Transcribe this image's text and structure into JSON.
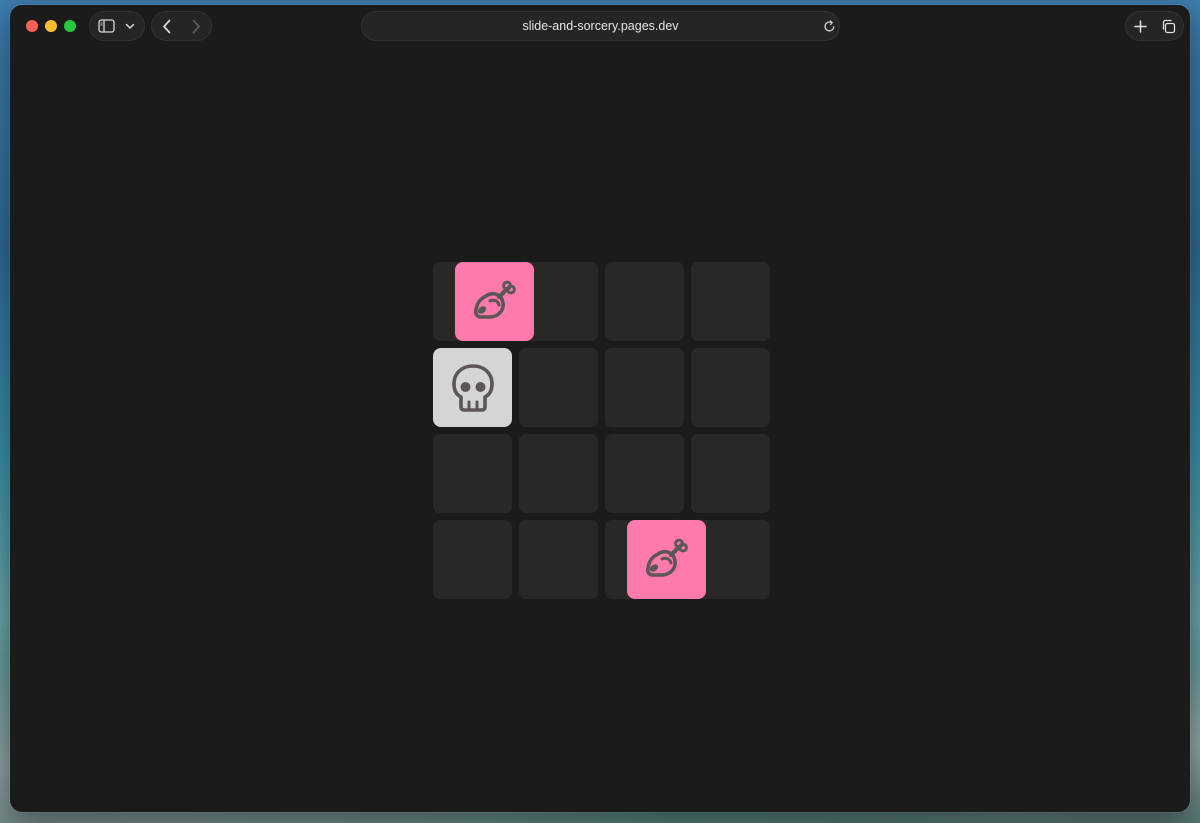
{
  "browser": {
    "url": "slide-and-sorcery.pages.dev",
    "icons": {
      "sidebar_toggle": "sidebar-icon",
      "sidebar_menu": "chevron-down-icon",
      "back": "chevron-left-icon",
      "forward": "chevron-right-icon",
      "reload": "reload-icon",
      "new_tab": "plus-icon",
      "tabs_overview": "tabs-icon"
    },
    "colors": {
      "window_bg": "#1c1b1b",
      "toolbar_pill": "#262525",
      "close": "#fe5f57",
      "minimize": "#febc2e",
      "maximize": "#28c840"
    }
  },
  "game": {
    "grid": {
      "rows": 4,
      "cols": 4
    },
    "tiles": [
      {
        "kind": "food",
        "icon": "meat-icon",
        "row": 0,
        "col": 0.26
      },
      {
        "kind": "enemy",
        "icon": "skull-icon",
        "row": 1,
        "col": 0
      },
      {
        "kind": "food",
        "icon": "meat-icon",
        "row": 3,
        "col": 2.26
      }
    ],
    "colors": {
      "cell": "#2a2727",
      "food_tile": "#fe7aab",
      "enemy_tile": "#d6d5d5",
      "icon": "#5b5757"
    }
  }
}
